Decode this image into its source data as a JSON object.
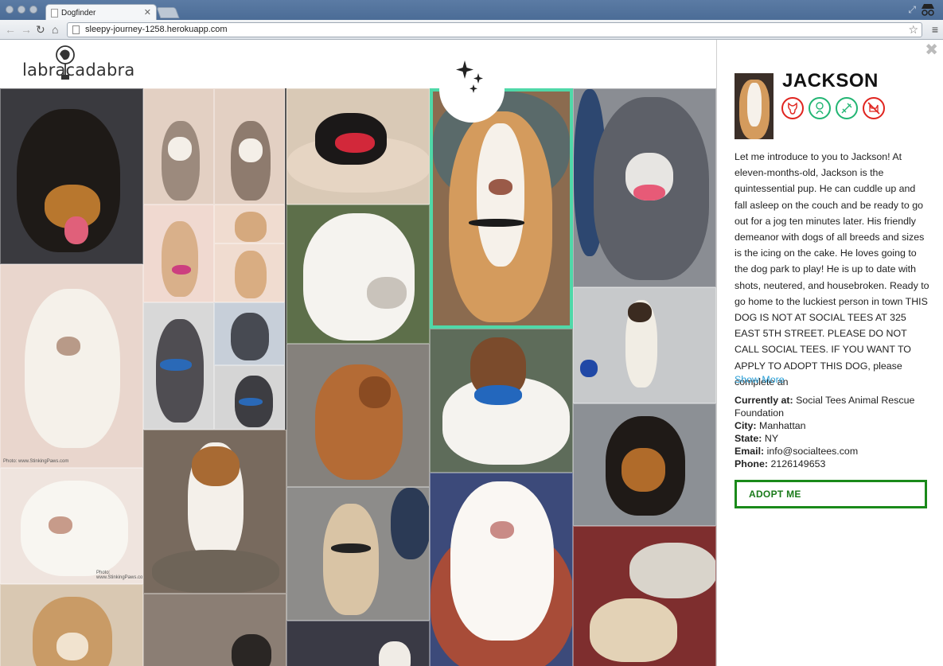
{
  "browser": {
    "tab_title": "Dogfinder",
    "url": "sleepy-journey-1258.herokuapp.com"
  },
  "header": {
    "logo_text": "labracadabra"
  },
  "grid": {
    "photo_credit_1": "Photo: www.StinkingPaws.com",
    "photo_credit_2": "Photo: www.StinkingPaws.com"
  },
  "detail": {
    "name": "JACKSON",
    "badges": [
      {
        "icon": "dog-friendly-icon",
        "color": "#e0241f"
      },
      {
        "icon": "kid-friendly-icon",
        "color": "#22b573"
      },
      {
        "icon": "house-trained-icon",
        "color": "#22b573"
      },
      {
        "icon": "no-cats-icon",
        "color": "#e0241f"
      }
    ],
    "description": "Let me introduce to you to Jackson! At eleven-months-old, Jackson is the quintessential pup. He can cuddle up and fall asleep on the couch and be ready to go out for a jog ten minutes later. His friendly demeanor with dogs of all breeds and sizes is the icing on the cake. He loves going to the dog park to play! He is up to date with shots, neutered, and housebroken. Ready to go home to the luckiest person in town THIS DOG IS NOT AT SOCIAL TEES AT 325 EAST 5TH STREET. PLEASE DO NOT CALL SOCIAL TEES. IF YOU WANT TO APPLY TO ADOPT THIS DOG, please complete an",
    "show_more": "Show More",
    "location_label": "Currently at:",
    "location_value": "Social Tees Animal Rescue Foundation",
    "city_label": "City:",
    "city_value": "Manhattan",
    "state_label": "State:",
    "state_value": "NY",
    "email_label": "Email:",
    "email_value": "info@socialtees.com",
    "phone_label": "Phone:",
    "phone_value": "2126149653",
    "adopt_label": "ADOPT ME"
  },
  "colors": {
    "selected_border": "#4fd8a8",
    "adopt_green": "#1a8a1a",
    "link_blue": "#2a9fd6"
  }
}
